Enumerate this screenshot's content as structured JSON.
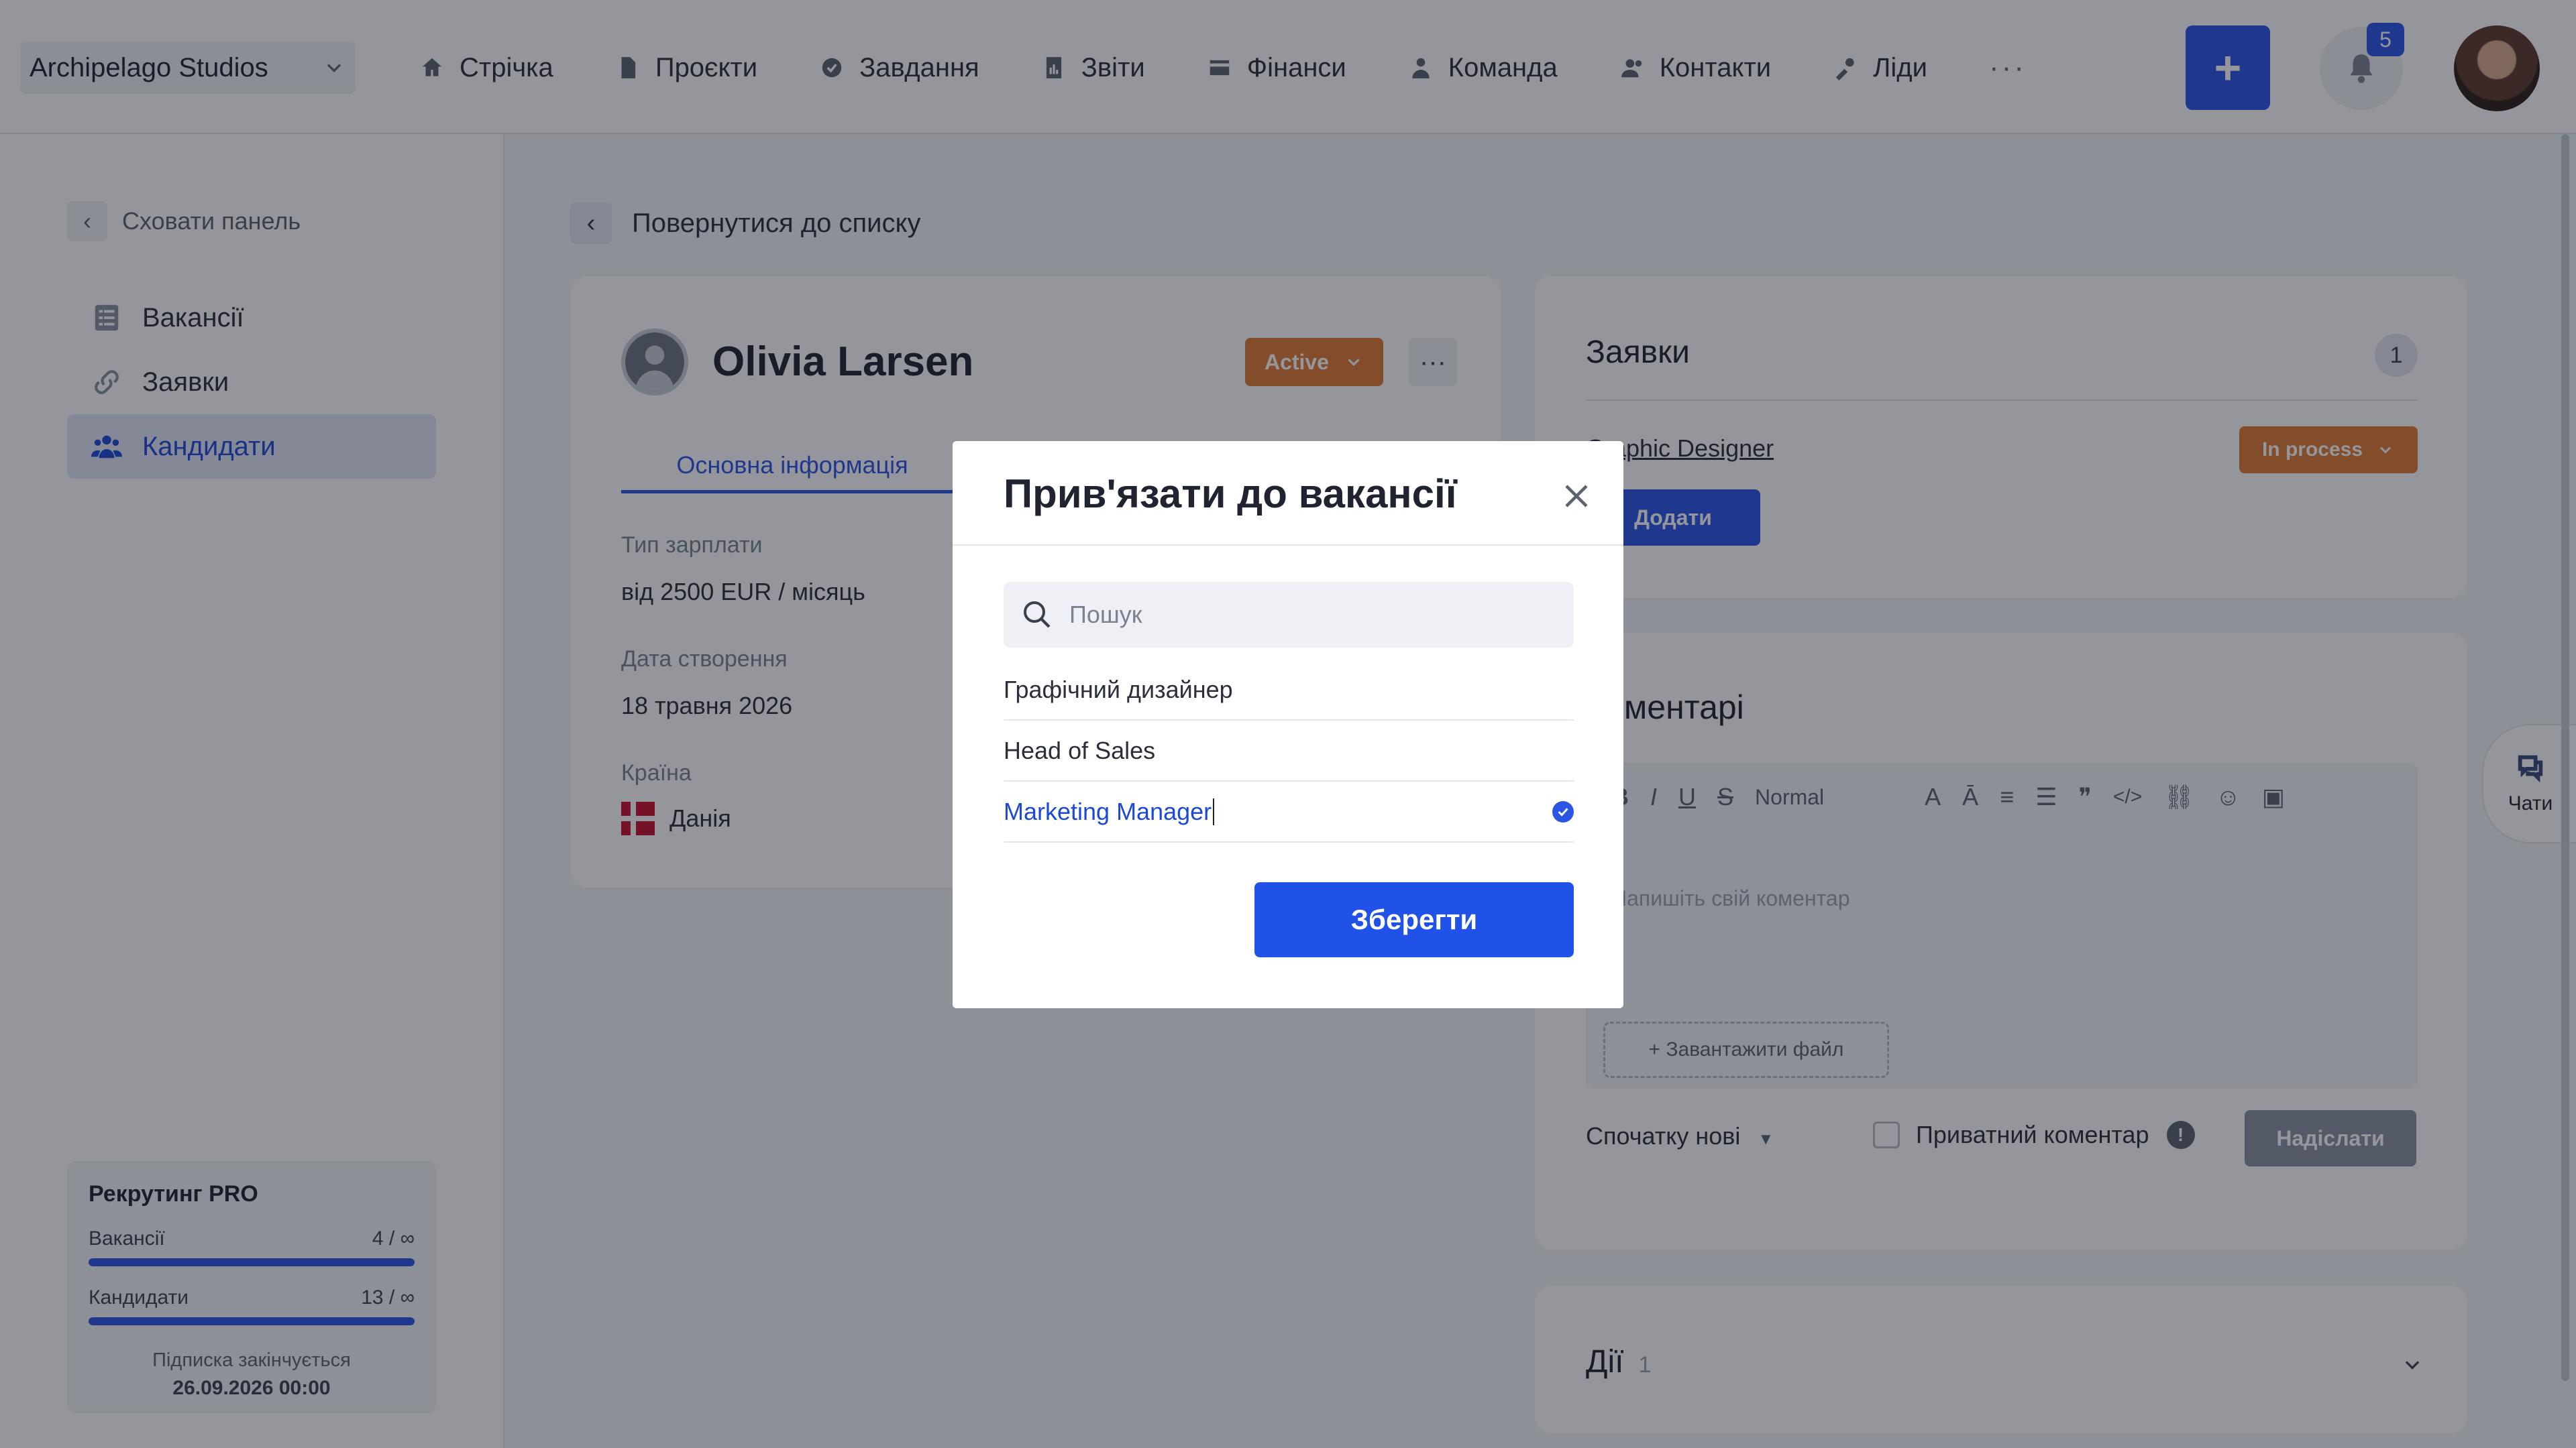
{
  "workspace": {
    "name": "Archipelago Studios"
  },
  "nav": {
    "items": [
      {
        "label": "Стрічка",
        "icon": "home-icon"
      },
      {
        "label": "Проєкти",
        "icon": "file-icon"
      },
      {
        "label": "Завдання",
        "icon": "check-circle-icon"
      },
      {
        "label": "Звіти",
        "icon": "report-icon"
      },
      {
        "label": "Фінанси",
        "icon": "wallet-icon"
      },
      {
        "label": "Команда",
        "icon": "person-icon"
      },
      {
        "label": "Контакти",
        "icon": "contacts-icon"
      },
      {
        "label": "Ліди",
        "icon": "leads-icon"
      }
    ],
    "more": "···",
    "add": "+",
    "notifications_count": "5"
  },
  "sidebar": {
    "hide_panel": "Сховати панель",
    "items": [
      {
        "label": "Вакансії",
        "icon": "list-icon",
        "active": false
      },
      {
        "label": "Заявки",
        "icon": "link-icon",
        "active": false
      },
      {
        "label": "Кандидати",
        "icon": "people-icon",
        "active": true
      }
    ],
    "plan": {
      "title": "Рекрутинг PRO",
      "rows": [
        {
          "label": "Вакансії",
          "value": "4 / ∞"
        },
        {
          "label": "Кандидати",
          "value": "13 / ∞"
        }
      ],
      "expires_label": "Підписка закінчується",
      "expires_date": "26.09.2026 00:00"
    }
  },
  "main": {
    "back_label": "Повернутися до списку",
    "candidate": {
      "name": "Olivia Larsen",
      "status": "Active",
      "tab": "Основна інформація",
      "fields": [
        {
          "label": "Тип зарплати",
          "value": "від 2500 EUR / місяць"
        },
        {
          "label": "Дата створення",
          "value": "18 травня 2026"
        },
        {
          "label": "Країна",
          "value": "Данія"
        }
      ]
    },
    "applications": {
      "title": "Заявки",
      "count": "1",
      "job": "Graphic Designer",
      "status": "In process",
      "add_label": "Додати"
    },
    "comments": {
      "title": "Коментарі",
      "toolbar_format": "Normal",
      "placeholder": "Напишіть свій коментар",
      "upload_label": "+ Завантажити файл",
      "sort_label": "Спочатку нові",
      "private_label": "Приватний коментар",
      "send_label": "Надіслати"
    },
    "actions": {
      "title": "Дії",
      "count": "1"
    }
  },
  "chats": {
    "label": "Чати"
  },
  "modal": {
    "title": "Прив'язати до вакансії",
    "search_placeholder": "Пошук",
    "vacancies": [
      {
        "label": "Графічний дизайнер",
        "selected": false
      },
      {
        "label": "Head of Sales",
        "selected": false
      },
      {
        "label": "Marketing Manager",
        "selected": true
      }
    ],
    "save_label": "Зберегти"
  },
  "colors": {
    "accent": "#2a55e5",
    "status_orange": "#e07832",
    "overlay": "#12162273"
  }
}
